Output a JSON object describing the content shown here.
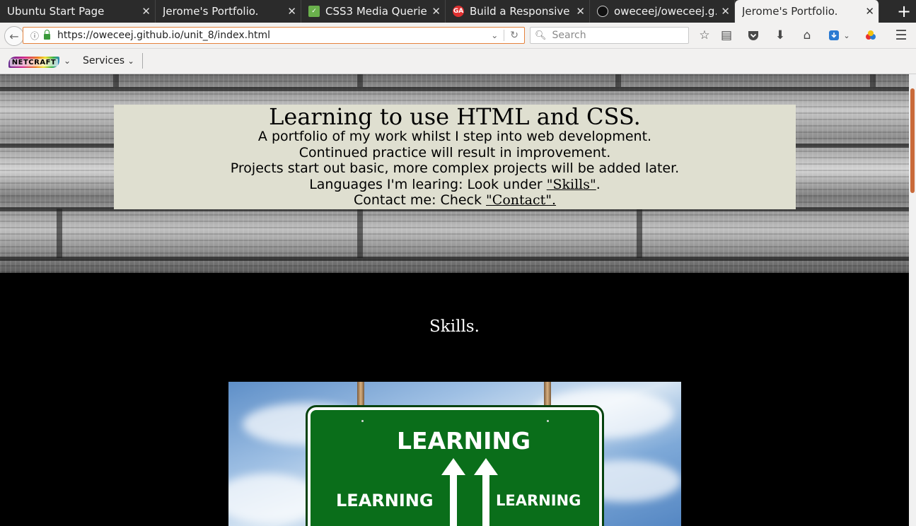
{
  "browser": {
    "tabs": [
      {
        "title": "Ubuntu Start Page",
        "favicon": "none",
        "active": false
      },
      {
        "title": "Jerome's Portfolio.",
        "favicon": "none",
        "active": false
      },
      {
        "title": "CSS3 Media Querie…",
        "favicon": "css-icon",
        "active": false
      },
      {
        "title": "Build a Responsive …",
        "favicon": "ga-icon",
        "active": false
      },
      {
        "title": "oweceej/oweceej.g…",
        "favicon": "github-icon",
        "active": false
      },
      {
        "title": "Jerome's Portfolio.",
        "favicon": "none",
        "active": true
      }
    ],
    "close_glyph": "✕",
    "new_tab_glyph": "+",
    "url": "https://oweceej.github.io/unit_8/index.html",
    "search_placeholder": "Search",
    "favicon_labels": {
      "css": "✓",
      "ga": "GA"
    }
  },
  "bookmarks": {
    "netcraft_label": "NETCRAFT",
    "services_label": "Services"
  },
  "hero": {
    "title": "Learning to use HTML and CSS.",
    "lines": [
      "A portfolio of my work whilst I step into web development.",
      "Continued practice will result in improvement.",
      "Projects start out basic, more complex projects will be added later."
    ],
    "languages_prefix": "Languages I'm learing: Look under ",
    "skills_link": "\"Skills\"",
    "languages_suffix": ".",
    "contact_prefix": "Contact me: Check ",
    "contact_link": "\"Contact\".",
    "box_color": "#dfdfd0"
  },
  "skills": {
    "heading": "Skills.",
    "sign_main": "LEARNING",
    "sign_left": "LEARNING",
    "sign_right": "LEARNING",
    "sign_color": "#0a6e1a"
  },
  "colors": {
    "tabstrip": "#2b2b2b",
    "toolbar": "#f2f1f0",
    "urlbar_focus": "#e5833d",
    "page_bg": "#000000"
  }
}
